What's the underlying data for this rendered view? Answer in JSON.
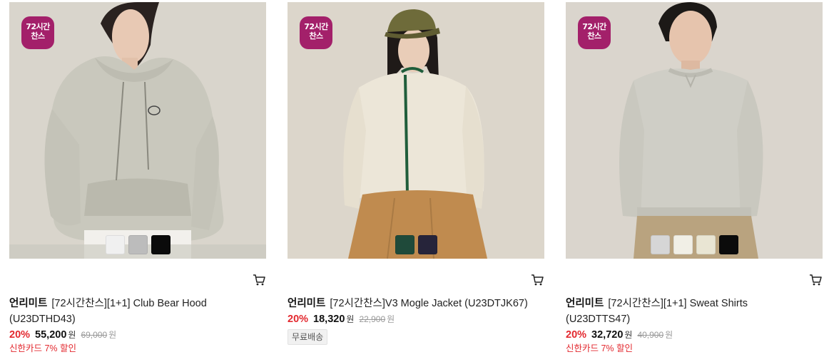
{
  "products": [
    {
      "badge": [
        "72시간",
        "찬스"
      ],
      "brand": "언리미트",
      "name": "[72시간찬스][1+1] Club Bear Hood",
      "name2": "(U23DTHD43)",
      "discount": "20%",
      "price": "55,200",
      "won": "원",
      "original": "69,000",
      "original_won": "원",
      "promo": "신한카드 7% 할인",
      "swatches": [
        "#f0f0f0",
        "#bcbcbc",
        "#0b0b0b"
      ],
      "icon": "cart-icon"
    },
    {
      "badge": [
        "72시간",
        "찬스"
      ],
      "brand": "언리미트",
      "name": "[72시간찬스]V3 Mogle Jacket (U23DTJK67)",
      "discount": "20%",
      "price": "18,320",
      "won": "원",
      "original": "22,900",
      "original_won": "원",
      "shipping": "무료배송",
      "swatches": [
        "#1f4a3a",
        "#26243a"
      ],
      "icon": "cart-icon"
    },
    {
      "badge": [
        "72시간",
        "찬스"
      ],
      "brand": "언리미트",
      "name": "[72시간찬스][1+1] Sweat Shirts",
      "name2": "(U23DTTS47)",
      "discount": "20%",
      "price": "32,720",
      "won": "원",
      "original": "40,900",
      "original_won": "원",
      "promo": "신한카드 7% 할인",
      "swatches": [
        "#d6d6d6",
        "#f1efe6",
        "#e9e5d3",
        "#0b0b0b"
      ],
      "icon": "cart-icon"
    }
  ],
  "colors": {
    "badge": "#a3206a",
    "discount": "#e3292f",
    "promo": "#e3292f"
  }
}
